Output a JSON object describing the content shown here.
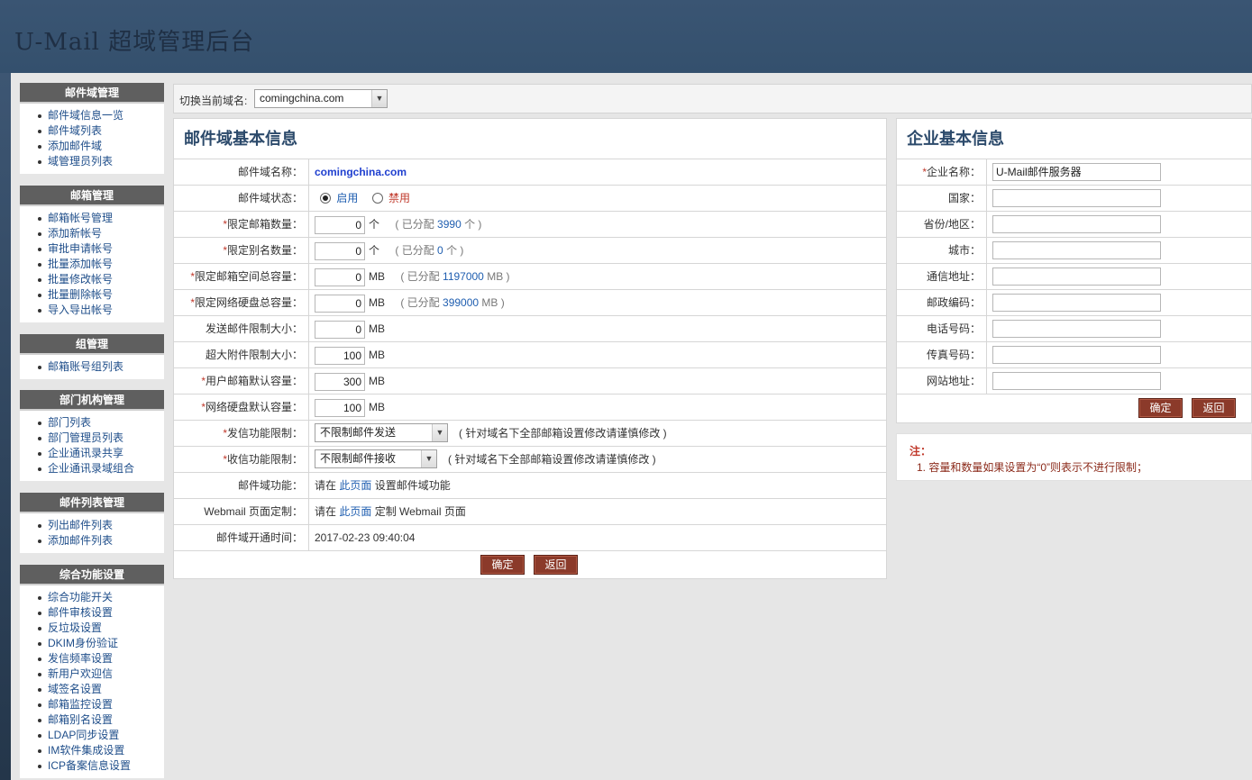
{
  "app": {
    "title": "U-Mail 超域管理后台"
  },
  "sidebar": {
    "groups": [
      {
        "title": "邮件域管理",
        "items": [
          "邮件域信息一览",
          "邮件域列表",
          "添加邮件域",
          "域管理员列表"
        ]
      },
      {
        "title": "邮箱管理",
        "items": [
          "邮箱帐号管理",
          "添加新帐号",
          "审批申请帐号",
          "批量添加帐号",
          "批量修改帐号",
          "批量删除帐号",
          "导入导出帐号"
        ]
      },
      {
        "title": "组管理",
        "items": [
          "邮箱账号组列表"
        ]
      },
      {
        "title": "部门机构管理",
        "items": [
          "部门列表",
          "部门管理员列表",
          "企业通讯录共享",
          "企业通讯录域组合"
        ]
      },
      {
        "title": "邮件列表管理",
        "items": [
          "列出邮件列表",
          "添加邮件列表"
        ]
      },
      {
        "title": "综合功能设置",
        "items": [
          "综合功能开关",
          "邮件审核设置",
          "反垃圾设置",
          "DKIM身份验证",
          "发信频率设置",
          "新用户欢迎信",
          "域签名设置",
          "邮箱监控设置",
          "邮箱别名设置",
          "LDAP同步设置",
          "IM软件集成设置",
          "ICP备案信息设置"
        ]
      }
    ]
  },
  "switchbar": {
    "label": "切换当前域名:",
    "selected": "comingchina.com"
  },
  "domain_panel": {
    "title": "邮件域基本信息",
    "name_label": "邮件域名称：",
    "name_value": "comingchina.com",
    "status_label": "邮件域状态：",
    "status_enabled": "启用",
    "status_disabled": "禁用",
    "mailbox_count_label": "限定邮箱数量：",
    "mailbox_count": "0",
    "mailbox_count_unit": "个",
    "mailbox_alloc_prefix": "( 已分配",
    "mailbox_alloc": "3990",
    "mailbox_alloc_suffix": "个 )",
    "alias_count_label": "限定别名数量：",
    "alias_count": "0",
    "alias_count_unit": "个",
    "alias_alloc_prefix": "( 已分配",
    "alias_alloc": "0",
    "alias_alloc_suffix": "个 )",
    "mailbox_space_label": "限定邮箱空间总容量：",
    "mailbox_space": "0",
    "mailbox_space_unit": "MB",
    "mailbox_space_alloc_prefix": "( 已分配",
    "mailbox_space_alloc": "1197000",
    "mailbox_space_alloc_suffix": "MB )",
    "disk_space_label": "限定网络硬盘总容量：",
    "disk_space": "0",
    "disk_space_unit": "MB",
    "disk_space_alloc_prefix": "( 已分配",
    "disk_space_alloc": "399000",
    "disk_space_alloc_suffix": "MB )",
    "send_limit_label": "发送邮件限制大小：",
    "send_limit": "0",
    "send_limit_unit": "MB",
    "attach_limit_label": "超大附件限制大小：",
    "attach_limit": "100",
    "attach_limit_unit": "MB",
    "user_quota_label": "用户邮箱默认容量：",
    "user_quota": "300",
    "user_quota_unit": "MB",
    "disk_quota_label": "网络硬盘默认容量：",
    "disk_quota": "100",
    "disk_quota_unit": "MB",
    "send_func_label": "发信功能限制：",
    "send_func_value": "不限制邮件发送",
    "send_func_note": "( 针对域名下全部邮箱设置修改请谨慎修改 )",
    "recv_func_label": "收信功能限制：",
    "recv_func_value": "不限制邮件接收",
    "recv_func_note": "( 针对域名下全部邮箱设置修改请谨慎修改 )",
    "domain_func_label": "邮件域功能：",
    "domain_func_pre": "请在",
    "domain_func_link": "此页面",
    "domain_func_post": "设置邮件域功能",
    "webmail_label": "Webmail 页面定制：",
    "webmail_pre": "请在",
    "webmail_link": "此页面",
    "webmail_post": "定制 Webmail 页面",
    "open_time_label": "邮件域开通时间：",
    "open_time": "2017-02-23 09:40:04",
    "ok_button": "确定",
    "back_button": "返回"
  },
  "company_panel": {
    "title": "企业基本信息",
    "fields": [
      {
        "label": "企业名称：",
        "required": true,
        "value": "U-Mail邮件服务器"
      },
      {
        "label": "国家：",
        "required": false,
        "value": ""
      },
      {
        "label": "省份/地区：",
        "required": false,
        "value": ""
      },
      {
        "label": "城市：",
        "required": false,
        "value": ""
      },
      {
        "label": "通信地址：",
        "required": false,
        "value": ""
      },
      {
        "label": "邮政编码：",
        "required": false,
        "value": ""
      },
      {
        "label": "电话号码：",
        "required": false,
        "value": ""
      },
      {
        "label": "传真号码：",
        "required": false,
        "value": ""
      },
      {
        "label": "网站地址：",
        "required": false,
        "value": ""
      }
    ],
    "ok_button": "确定",
    "back_button": "返回"
  },
  "notes": {
    "title": "注：",
    "items": [
      "1. 容量和数量如果设置为“0”则表示不进行限制；"
    ]
  },
  "colors": {
    "header": "#3a5573",
    "button": "#8b3a2a",
    "nav_head": "#5f5f5f",
    "link": "#1f5eb0",
    "required": "#c0392b"
  }
}
